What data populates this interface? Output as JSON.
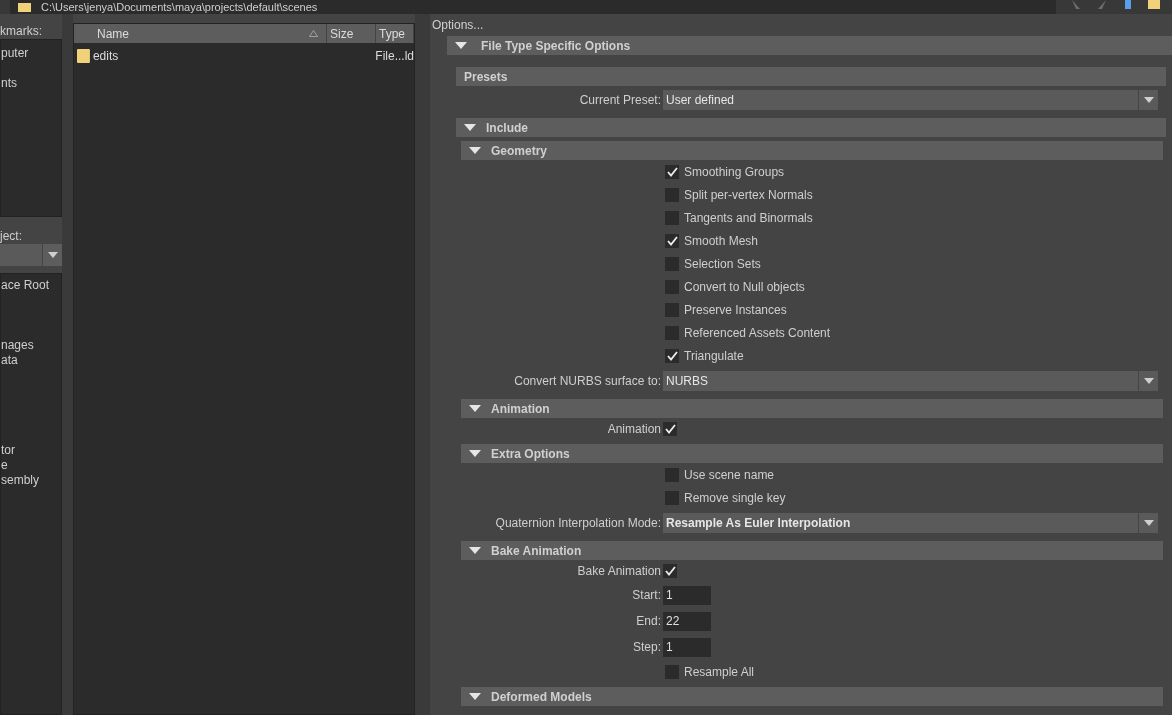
{
  "path_bar": {
    "path": "C:\\Users\\jenya\\Documents\\maya\\projects\\default\\scenes"
  },
  "bookmarks": {
    "label": "kmarks:",
    "items": [
      "puter",
      "nts"
    ]
  },
  "project": {
    "label": "ject:",
    "items": [
      "ace Root",
      "nages",
      "ata",
      "tor",
      "e",
      "sembly"
    ]
  },
  "file_list": {
    "columns": [
      {
        "label": "Name",
        "sorted": true
      },
      {
        "label": "Size",
        "sorted": false
      },
      {
        "label": "Type",
        "sorted": false
      }
    ],
    "rows": [
      {
        "name": "edits",
        "type": "File...ld"
      }
    ]
  },
  "options": {
    "title": "Options...",
    "sections": [
      {
        "title": "File Type Specific Options",
        "kind": "foldout",
        "expanded": true,
        "children": [
          {
            "title": "Presets",
            "kind": "group",
            "rows": [
              {
                "kind": "dropdown",
                "label": "Current Preset:",
                "value": "User defined",
                "bold": false
              }
            ]
          },
          {
            "title": "Include",
            "kind": "foldout",
            "expanded": true,
            "children": [
              {
                "title": "Geometry",
                "kind": "foldout",
                "expanded": true,
                "rows": [
                  {
                    "kind": "checkbox",
                    "label": "Smoothing Groups",
                    "checked": true
                  },
                  {
                    "kind": "checkbox",
                    "label": "Split per-vertex Normals",
                    "checked": false
                  },
                  {
                    "kind": "checkbox",
                    "label": "Tangents and Binormals",
                    "checked": false
                  },
                  {
                    "kind": "checkbox",
                    "label": "Smooth Mesh",
                    "checked": true
                  },
                  {
                    "kind": "checkbox",
                    "label": "Selection Sets",
                    "checked": false
                  },
                  {
                    "kind": "checkbox",
                    "label": "Convert to Null objects",
                    "checked": false
                  },
                  {
                    "kind": "checkbox",
                    "label": "Preserve Instances",
                    "checked": false
                  },
                  {
                    "kind": "checkbox",
                    "label": "Referenced Assets Content",
                    "checked": false
                  },
                  {
                    "kind": "checkbox",
                    "label": "Triangulate",
                    "checked": true
                  },
                  {
                    "kind": "dropdown",
                    "label": "Convert NURBS surface to:",
                    "value": "NURBS",
                    "bold": false
                  }
                ]
              },
              {
                "title": "Animation",
                "kind": "foldout",
                "expanded": true,
                "rows": [
                  {
                    "kind": "labeled-check",
                    "label": "Animation",
                    "checked": true
                  }
                ]
              },
              {
                "title": "Extra Options",
                "kind": "foldout",
                "expanded": true,
                "rows": [
                  {
                    "kind": "checkbox",
                    "label": "Use scene name",
                    "checked": false
                  },
                  {
                    "kind": "checkbox",
                    "label": "Remove single key",
                    "checked": false
                  },
                  {
                    "kind": "dropdown",
                    "label": "Quaternion Interpolation Mode:",
                    "value": "Resample As Euler Interpolation",
                    "bold": true
                  }
                ]
              },
              {
                "title": "Bake Animation",
                "kind": "foldout",
                "expanded": true,
                "rows": [
                  {
                    "kind": "labeled-check",
                    "label": "Bake Animation",
                    "checked": true
                  },
                  {
                    "kind": "field",
                    "label": "Start:",
                    "value": "1"
                  },
                  {
                    "kind": "field",
                    "label": "End:",
                    "value": "22"
                  },
                  {
                    "kind": "field",
                    "label": "Step:",
                    "value": "1"
                  },
                  {
                    "kind": "checkbox",
                    "label": "Resample All",
                    "checked": false
                  }
                ]
              },
              {
                "title": "Deformed Models",
                "kind": "foldout",
                "expanded": true
              }
            ]
          }
        ]
      }
    ]
  }
}
